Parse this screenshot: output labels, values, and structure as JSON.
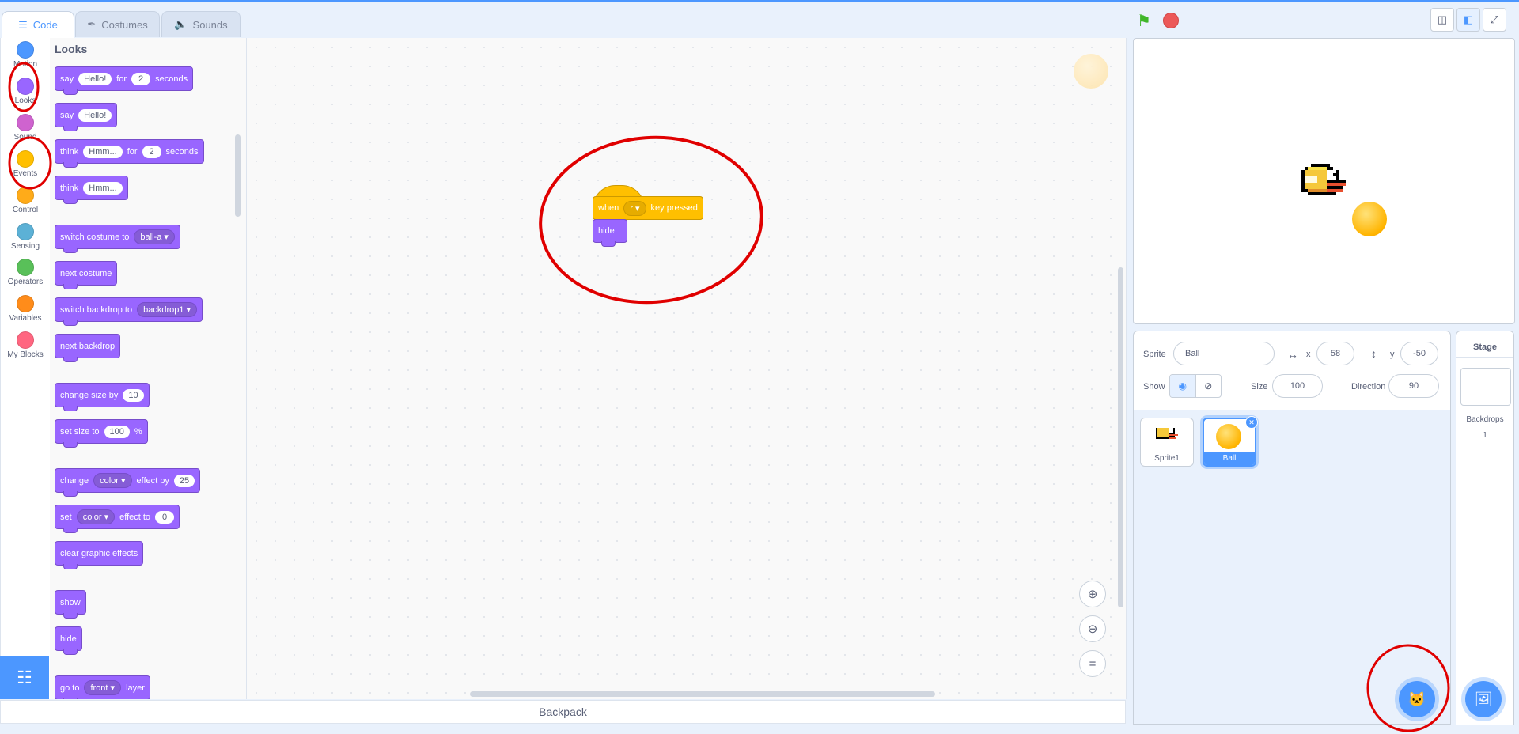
{
  "tabs": [
    {
      "label": "Code",
      "icon": "code-icon"
    },
    {
      "label": "Costumes",
      "icon": "brush-icon"
    },
    {
      "label": "Sounds",
      "icon": "speaker-icon"
    }
  ],
  "categories": [
    {
      "label": "Motion",
      "color": "#4c97ff"
    },
    {
      "label": "Looks",
      "color": "#9966ff"
    },
    {
      "label": "Sound",
      "color": "#cf63cf"
    },
    {
      "label": "Events",
      "color": "#ffbf00"
    },
    {
      "label": "Control",
      "color": "#ffab19"
    },
    {
      "label": "Sensing",
      "color": "#5cb1d6"
    },
    {
      "label": "Operators",
      "color": "#59c059"
    },
    {
      "label": "Variables",
      "color": "#ff8c1a"
    },
    {
      "label": "My Blocks",
      "color": "#ff6680"
    }
  ],
  "palette": {
    "title": "Looks",
    "say_for": {
      "word": "say",
      "text": "Hello!",
      "for": "for",
      "secs": "2",
      "unit": "seconds"
    },
    "say": {
      "word": "say",
      "text": "Hello!"
    },
    "think_for": {
      "word": "think",
      "text": "Hmm...",
      "for": "for",
      "secs": "2",
      "unit": "seconds"
    },
    "think": {
      "word": "think",
      "text": "Hmm..."
    },
    "switch_costume": {
      "text": "switch costume to",
      "value": "ball-a"
    },
    "next_costume": "next costume",
    "switch_backdrop": {
      "text": "switch backdrop to",
      "value": "backdrop1"
    },
    "next_backdrop": "next backdrop",
    "change_size": {
      "text": "change size by",
      "value": "10"
    },
    "set_size": {
      "text": "set size to",
      "value": "100",
      "unit": "%"
    },
    "change_effect": {
      "word": "change",
      "effect": "color",
      "text": "effect by",
      "value": "25"
    },
    "set_effect": {
      "word": "set",
      "effect": "color",
      "text": "effect to",
      "value": "0"
    },
    "clear_effects": "clear graphic effects",
    "show": "show",
    "hide": "hide",
    "go_to": {
      "word": "go to",
      "value": "front",
      "unit": "layer"
    }
  },
  "script": {
    "hat": {
      "when": "when",
      "key": "r",
      "pressed": "key pressed"
    },
    "hide": "hide"
  },
  "backpack": "Backpack",
  "sprite_info": {
    "sprite_label": "Sprite",
    "sprite_name": "Ball",
    "x_label": "x",
    "x": "58",
    "y_label": "y",
    "y": "-50",
    "show_label": "Show",
    "size_label": "Size",
    "size": "100",
    "direction_label": "Direction",
    "direction": "90"
  },
  "sprites": [
    {
      "name": "Sprite1",
      "selected": false
    },
    {
      "name": "Ball",
      "selected": true
    }
  ],
  "stage_pane": {
    "title": "Stage",
    "backdrops_label": "Backdrops",
    "backdrops_count": "1"
  }
}
